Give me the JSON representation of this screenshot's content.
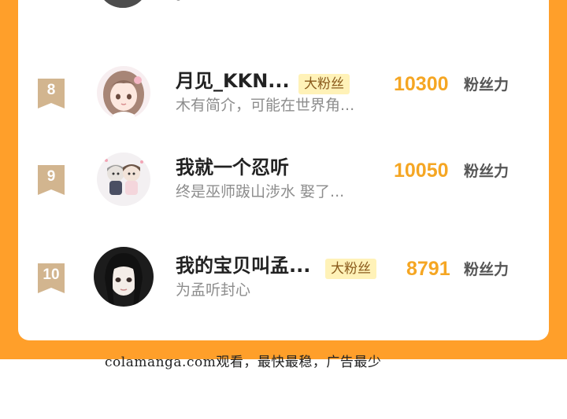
{
  "previous_row": {
    "desc": "。"
  },
  "ranking": [
    {
      "rank": "8",
      "name": "月见_KKN...",
      "tag": "大粉丝",
      "desc": "木有简介，可能在世界角...",
      "score": "10300",
      "score_unit": "粉丝力",
      "avatar_icon": "anime-girl-avatar"
    },
    {
      "rank": "9",
      "name": "我就一个忍听",
      "tag": "",
      "desc": "终是巫师跋山涉水 娶了...",
      "score": "10050",
      "score_unit": "粉丝力",
      "avatar_icon": "couple-chibi-avatar"
    },
    {
      "rank": "10",
      "name": "我的宝贝叫孟...",
      "tag": "大粉丝",
      "desc": "为孟听封心",
      "score": "8791",
      "score_unit": "粉丝力",
      "avatar_icon": "dark-hair-girl-avatar"
    }
  ],
  "watermark": "colamanga.com观看，最快最稳，广告最少",
  "colors": {
    "frame": "#ff9f2a",
    "score": "#f5a623",
    "tag_bg": "#fff2b8",
    "badge": "#d2b58f"
  }
}
